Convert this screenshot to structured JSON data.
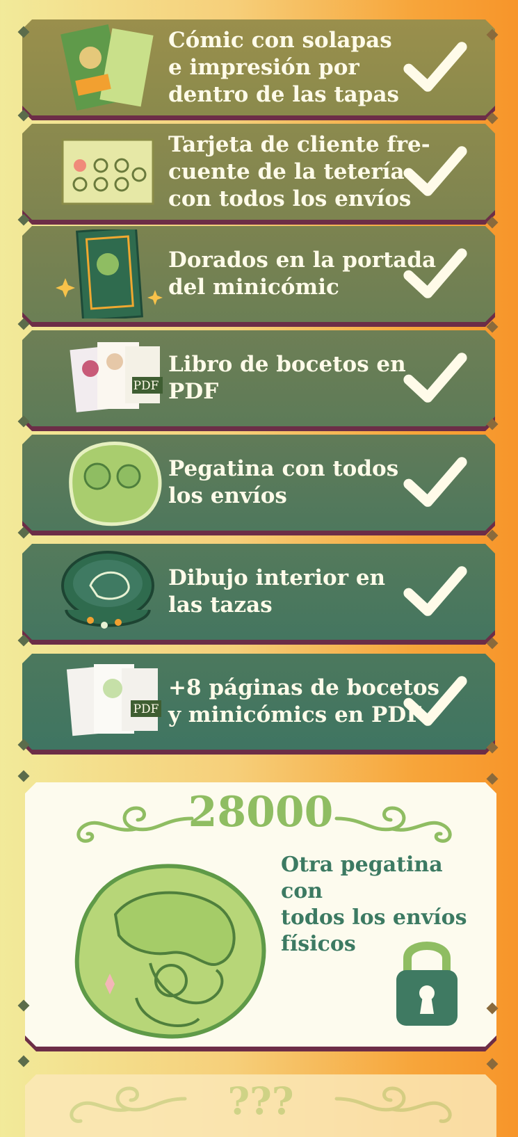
{
  "colors": {
    "card_top": "#8e8a4a",
    "card_bottom": "#3f7a62",
    "shadow": "#6c2d47",
    "text_light": "#fffbe9",
    "goal_green": "#8fbd62",
    "goal_text": "#3c7a62"
  },
  "rewards": [
    {
      "label": "Cómic con solapas\ne impresión por\ndentro de las tapas",
      "icon": "comic-cover-image",
      "unlocked": true
    },
    {
      "label": "Tarjeta de cliente fre-\ncuente de la tetería\ncon todos los envíos",
      "icon": "loyalty-card-image",
      "unlocked": true
    },
    {
      "label": "Dorados en la portada\ndel minicómic",
      "icon": "gold-cover-image",
      "unlocked": true
    },
    {
      "label": "Libro de bocetos en\nPDF",
      "icon": "sketchbook-pdf-image",
      "unlocked": true,
      "badge": "PDF"
    },
    {
      "label": "Pegatina con todos\nlos envíos",
      "icon": "sticker-image",
      "unlocked": true
    },
    {
      "label": "Dibujo interior en\nlas tazas",
      "icon": "cup-drawing-image",
      "unlocked": true
    },
    {
      "label": "+8 páginas de bocetos\ny minicómics en PDF",
      "icon": "extra-pages-pdf-image",
      "unlocked": true,
      "badge": "PDF"
    }
  ],
  "goal": {
    "amount": "28000",
    "text": "Otra pegatina con\ntodos los envíos\nfísicos",
    "icon": "padlock-icon",
    "locked": true
  },
  "next_goal": {
    "amount": "???"
  }
}
